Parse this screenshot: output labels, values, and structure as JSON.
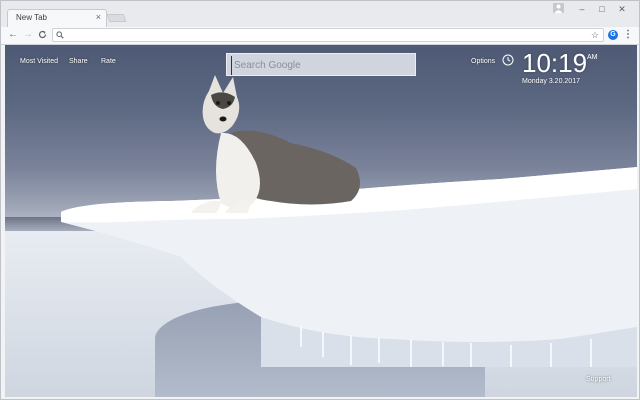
{
  "browser": {
    "tab": {
      "title": "New Tab",
      "close_glyph": "×"
    },
    "window_controls": {
      "minimize": "–",
      "maximize": "□",
      "close": "✕"
    },
    "toolbar": {
      "back_glyph": "←",
      "forward_glyph": "→",
      "reload_glyph": "C",
      "address_value": "",
      "star_glyph": "☆",
      "extension_badge": "G",
      "menu_glyph": "⋮"
    }
  },
  "newtab": {
    "top_links": [
      "Most Visited",
      "Share",
      "Rate"
    ],
    "search": {
      "placeholder": "Search Google"
    },
    "options_label": "Options",
    "clock": {
      "time": "10:19",
      "ampm": "AM",
      "date": "Monday  3.20.2017"
    },
    "support_label": "Support",
    "background": "husky on ice shelf"
  },
  "colors": {
    "accent": "#1a73e8",
    "sky_top": "#4e5a75",
    "snow": "#e8ecf2"
  }
}
